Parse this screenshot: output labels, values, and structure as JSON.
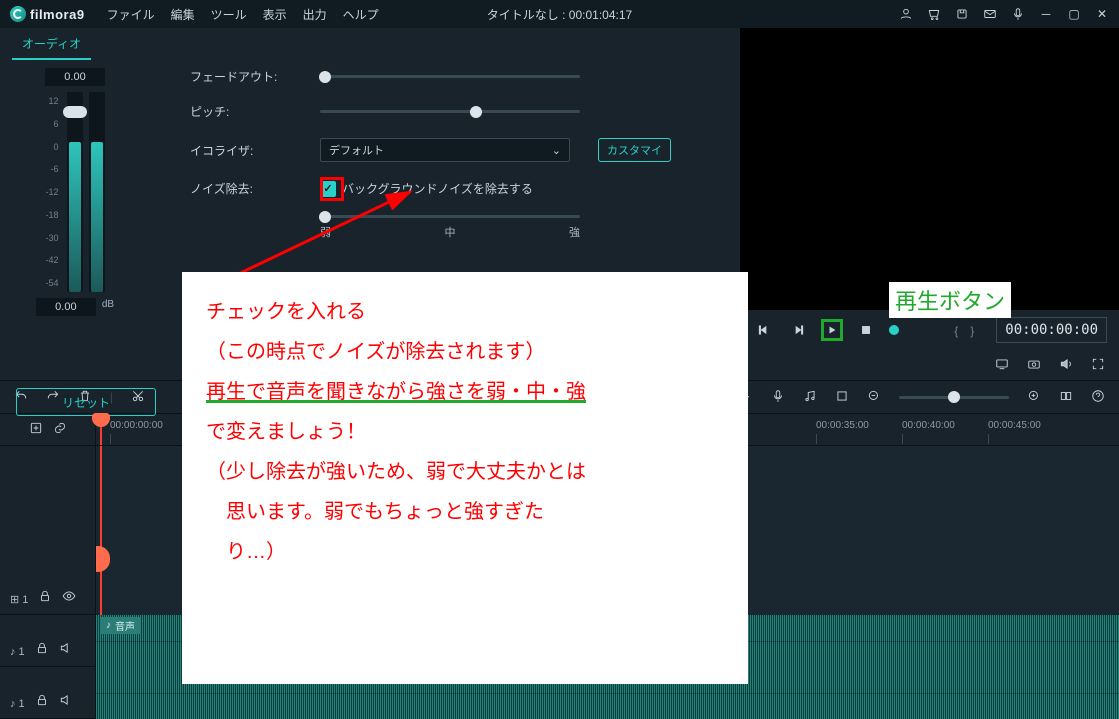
{
  "brand": "filmora9",
  "menu": [
    "ファイル",
    "編集",
    "ツール",
    "表示",
    "出力",
    "ヘルプ"
  ],
  "doc_title": "タイトルなし : 00:01:04:17",
  "tab_audio": "オーディオ",
  "meter": {
    "top": "0.00",
    "bottom": "0.00",
    "unit": "dB",
    "scale": [
      "12",
      "6",
      "0",
      "-6",
      "-12",
      "-18",
      "-30",
      "-42",
      "-54"
    ]
  },
  "controls": {
    "fadeout": "フェードアウト:",
    "pitch": "ピッチ:",
    "eq_label": "イコライザ:",
    "eq_value": "デフォルト",
    "eq_custom": "カスタマイ",
    "noise_label": "ノイズ除去:",
    "noise_check_text": "バックグラウンドノイズを除去する",
    "noise_levels": [
      "弱",
      "中",
      "強"
    ]
  },
  "reset": "リセット",
  "note_lines": [
    "チェックを入れる",
    "（この時点でノイズが除去されます）",
    "再生で音声を聞きながら強さを弱・中・強",
    "で変えましょう！",
    "（少し除去が強いため、弱で大丈夫かとは",
    "　思います。弱でもちょっと強すぎた",
    "　り…）"
  ],
  "play_label": "再生ボタン",
  "transport": {
    "braces": "{　}",
    "tc": "00:00:00:00"
  },
  "ruler": {
    "visible_tc": "00:00:00:00",
    "far_ticks": [
      "00:00:35:00",
      "00:00:40:00",
      "00:00:45:00"
    ]
  },
  "audio_track_label": "音声",
  "track_heads": {
    "video": "⊞ 1",
    "audio": "♪ 1"
  }
}
